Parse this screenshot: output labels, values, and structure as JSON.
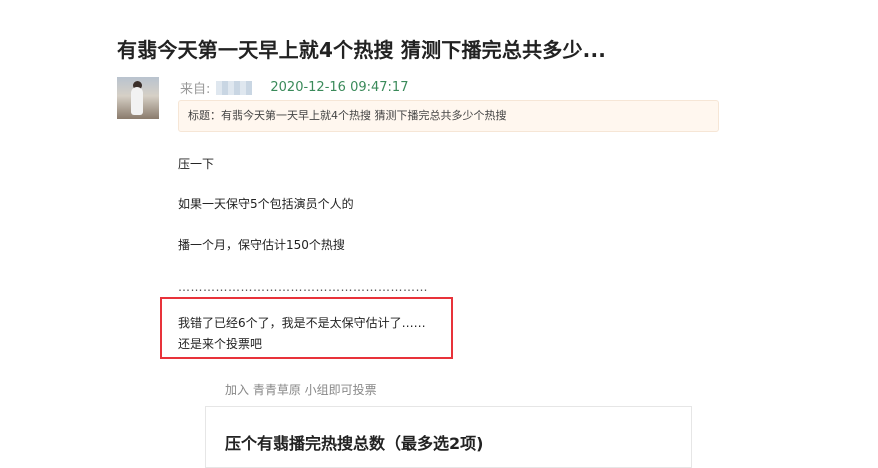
{
  "post": {
    "title": "有翡今天第一天早上就4个热搜 猜测下播完总共多少...",
    "from_label": "来自:",
    "timestamp": "2020-12-16 09:47:17",
    "title_box": "标题：有翡今天第一天早上就4个热搜 猜测下播完总共多少个热搜"
  },
  "body": {
    "p1": "压一下",
    "p2": "如果一天保守5个包括演员个人的",
    "p3": "播一个月，保守估计150个热搜",
    "dots": "……………………………………………………",
    "highlight_line1": "我错了已经6个了，我是不是太保守估计了……",
    "highlight_line2": "还是来个投票吧"
  },
  "poll": {
    "join_hint": "加入 青青草原 小组即可投票",
    "title": "压个有翡播完热搜总数（最多选2项)"
  }
}
